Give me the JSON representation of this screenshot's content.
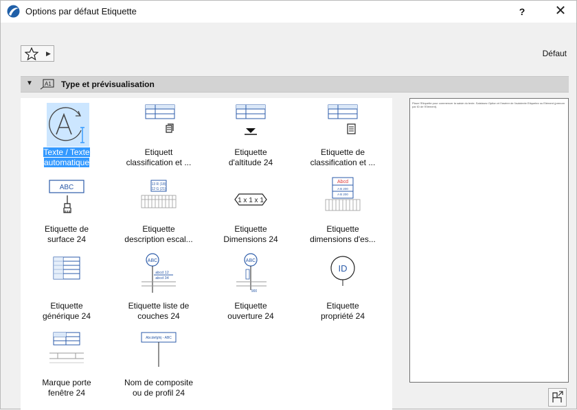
{
  "window": {
    "title": "Options par défaut Etiquette",
    "help_label": "?",
    "close_label": "✕"
  },
  "toolbar": {
    "default_label": "Défaut"
  },
  "section": {
    "title": "Type et prévisualisation"
  },
  "items": [
    {
      "label": "Texte / Texte\nautomatique",
      "selected": true
    },
    {
      "label": "Etiquett\nclassification et ..."
    },
    {
      "label": "Etiquette\nd'altitude 24"
    },
    {
      "label": "Etiquette de\nclassification et ..."
    },
    {
      "label": "Etiquette de\nsurface 24"
    },
    {
      "label": "Etiquette\ndescription escal..."
    },
    {
      "label": "Etiquette\nDimensions 24"
    },
    {
      "label": "Etiquette\ndimensions d'es..."
    },
    {
      "label": "Etiquette\ngénérique 24"
    },
    {
      "label": "Etiquette liste de\ncouches 24"
    },
    {
      "label": "Etiquette\nouverture 24"
    },
    {
      "label": "Etiquette\npropriété 24"
    },
    {
      "label": "Marque porte\nfenêtre 24"
    },
    {
      "label": "Nom de composite\nou de profil 24"
    }
  ],
  "icon_text": {
    "surface_abc": "ABC",
    "dimensions": "1 x 1 x 1",
    "stair_dims": "Abcd",
    "stair_1": "A B 200",
    "stair_2": "A B 200",
    "desc_1": "13 R (18)",
    "desc_2": "12 G (21)",
    "layer_abc": "ABC",
    "layer_1": "abcd 12",
    "layer_2": "abcd 34",
    "opening_abc": "ABC",
    "opening_num": "900",
    "property_id": "ID",
    "composite": "Abcdefghij - ABC"
  },
  "preview": {
    "text": "Place l'Etiquette pour commencer la saisie du texte.\nSaisissez Option et l'insérer de l'autotexte Etiquetez ou Elément (prenom par ID de l'Elément)."
  }
}
